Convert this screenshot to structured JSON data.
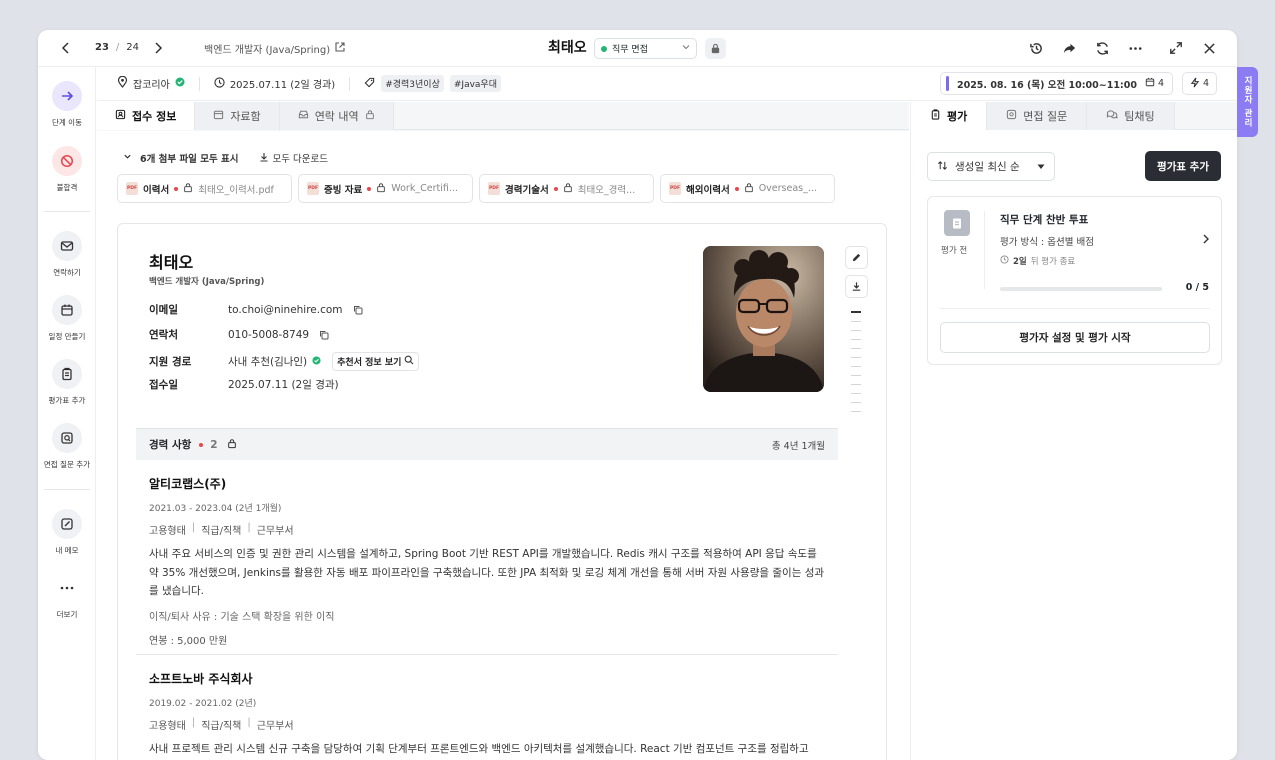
{
  "topbar": {
    "pager_current": "23",
    "pager_sep": "/",
    "pager_total": "24",
    "job_title": "백엔드 개발자 (Java/Spring)",
    "candidate_name": "최태오",
    "stage": "직무 면접",
    "stage_color": "#22b573"
  },
  "leftbar": {
    "items": [
      {
        "label": "단계 이동",
        "icon": "arrow-right-icon"
      },
      {
        "label": "불합격",
        "icon": "ban-icon"
      },
      {
        "label": "연락하기",
        "icon": "mail-icon"
      },
      {
        "label": "일정 만들기",
        "icon": "calendar-icon"
      },
      {
        "label": "평가표 추가",
        "icon": "clipboard-icon"
      },
      {
        "label": "면접 질문 추가",
        "icon": "question-icon"
      },
      {
        "label": "내 메모",
        "icon": "edit-icon"
      },
      {
        "label": "더보기",
        "icon": "more-icon"
      }
    ]
  },
  "infobar": {
    "source": "잡코리아",
    "applied": "2025.07.11 (2일 경과)",
    "tags": [
      "#경력3년이상",
      "#Java우대"
    ],
    "schedule": "2025. 08. 16 (목) 오전 10:00~11:00",
    "schedule_count": "4",
    "flash_count": "4",
    "side_tab": "지원자 관리"
  },
  "left_tabs": [
    "접수 정보",
    "자료함",
    "연락 내역"
  ],
  "attachments": {
    "header": "6개 첨부 파일 모두 표시",
    "download_all": "모두 다운로드",
    "files": [
      {
        "name": "이력서",
        "sub": "최태오_이력서.pdf"
      },
      {
        "name": "증빙 자료",
        "sub": "Work_Certifi..."
      },
      {
        "name": "경력기술서",
        "sub": "최태오_경력..."
      },
      {
        "name": "해외이력서",
        "sub": "Overseas_..."
      }
    ],
    "pdf_label": "PDF"
  },
  "profile": {
    "name": "최태오",
    "job": "백엔드 개발자 (Java/Spring)",
    "email_label": "이메일",
    "email": "to.choi@ninehire.com",
    "phone_label": "연락처",
    "phone": "010-5008-8749",
    "route_label": "지원 경로",
    "route": "사내 추천(김나인)",
    "referral_btn": "추천서 정보 보기",
    "date_label": "접수일",
    "date": "2025.07.11 (2일 경과)"
  },
  "career": {
    "title": "경력 사항",
    "count": "2",
    "total": "총 4년 1개월",
    "items": [
      {
        "company": "알티코랩스(주)",
        "period": "2021.03 - 2023.04 (2년 1개월)",
        "meta": [
          "고용형태",
          "|",
          "직급/직책",
          "|",
          "근무부서"
        ],
        "desc": "사내 주요 서비스의 인증 및 권한 관리 시스템을 설계하고, Spring Boot 기반 REST API를 개발했습니다. Redis 캐시 구조를 적용하여 API 응답 속도를 약 35% 개선했으며, Jenkins를 활용한 자동 배포 파이프라인을 구축했습니다. 또한 JPA 최적화 및 로깅 체계 개선을 통해 서버 자원 사용량을 줄이는 성과를 냈습니다.",
        "reason": "이직/퇴사 사유 : 기술 스택 확장을 위한 이직",
        "salary": "연봉 : 5,000 만원"
      },
      {
        "company": "소프트노바 주식회사",
        "period": "2019.02 - 2021.02 (2년)",
        "meta": [
          "고용형태",
          "|",
          "직급/직책",
          "|",
          "근무부서"
        ],
        "desc": "사내 프로젝트 관리 시스템 신규 구축을 담당하여 기획 단계부터 프론트엔드와 백엔드 아키텍처를 설계했습니다. React 기반 컴포넌트 구조를 정립하고"
      }
    ]
  },
  "right_tabs": [
    "평가",
    "면접 질문",
    "팀채팅"
  ],
  "evaluation": {
    "sort_label": "생성일 최신 순",
    "add_button": "평가표 추가",
    "status": "평가 전",
    "title": "직무 단계 찬반 투표",
    "method": "평가 방식 : 옵션별 배점",
    "end_days": "2일",
    "end_suffix": "뒤 평가 종료",
    "progress_text": "0 / 5",
    "progress_fraction": 0,
    "start_button": "평가자 설정 및 평가 시작"
  },
  "colors": {
    "accent": "#7c6cf0",
    "required_dot": "#e5484d",
    "ok": "#22b573"
  }
}
